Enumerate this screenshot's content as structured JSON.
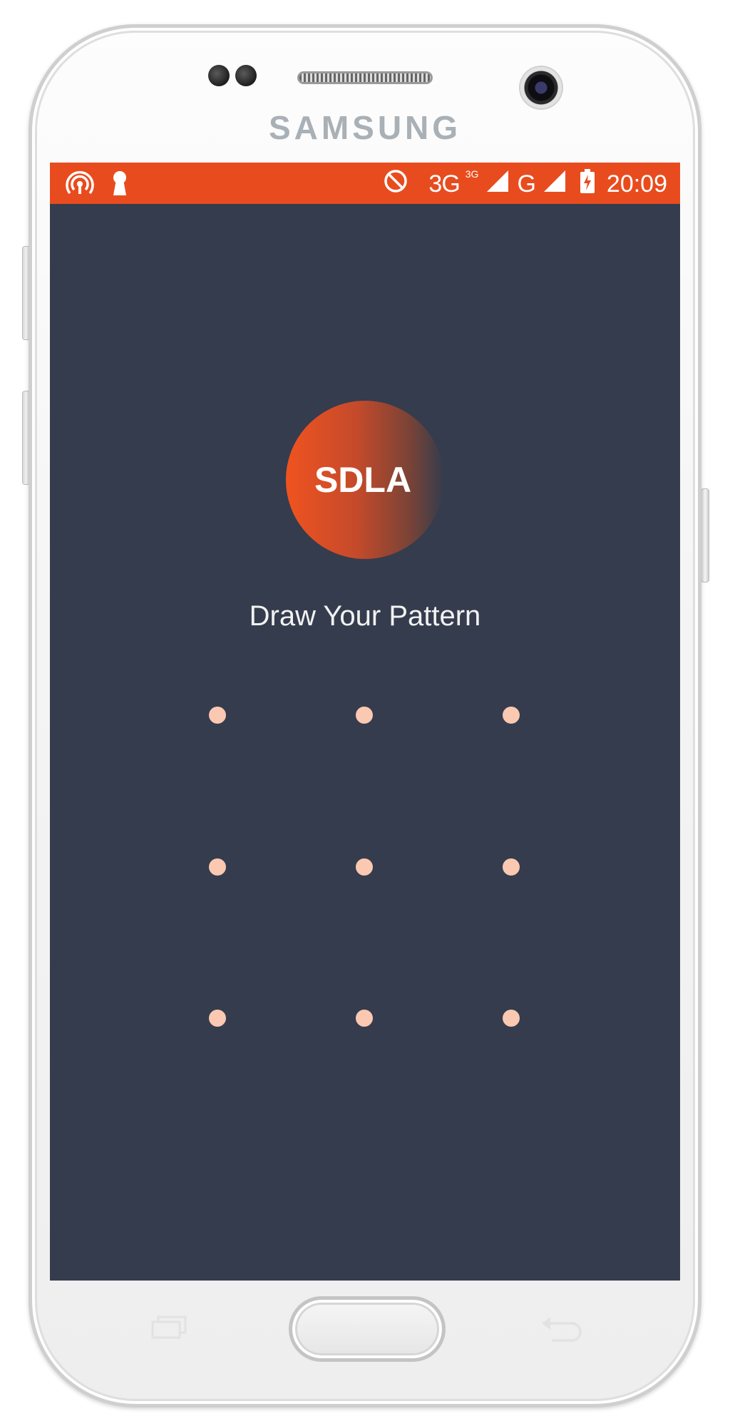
{
  "device": {
    "brand": "SAMSUNG"
  },
  "status_bar": {
    "left_icons": [
      "hotspot-icon",
      "keyhole-icon"
    ],
    "right_icons": [
      "do-not-disturb-icon",
      "signal-3g-icon",
      "signal-g-icon",
      "battery-charging-icon"
    ],
    "network_primary": "3G",
    "network_sup": "3G",
    "network_secondary": "G",
    "time": "20:09",
    "color": "#e84c1e"
  },
  "lock_screen": {
    "logo_text": "SDLA",
    "prompt": "Draw Your Pattern",
    "background_color": "#353c4d",
    "dot_color": "#fbc8b2",
    "pattern_dots": [
      {
        "id": 1
      },
      {
        "id": 2
      },
      {
        "id": 3
      },
      {
        "id": 4
      },
      {
        "id": 5
      },
      {
        "id": 6
      },
      {
        "id": 7
      },
      {
        "id": 8
      },
      {
        "id": 9
      }
    ]
  },
  "hardware_buttons": {
    "icons": [
      "recent-apps-icon",
      "home-button",
      "back-icon"
    ]
  }
}
